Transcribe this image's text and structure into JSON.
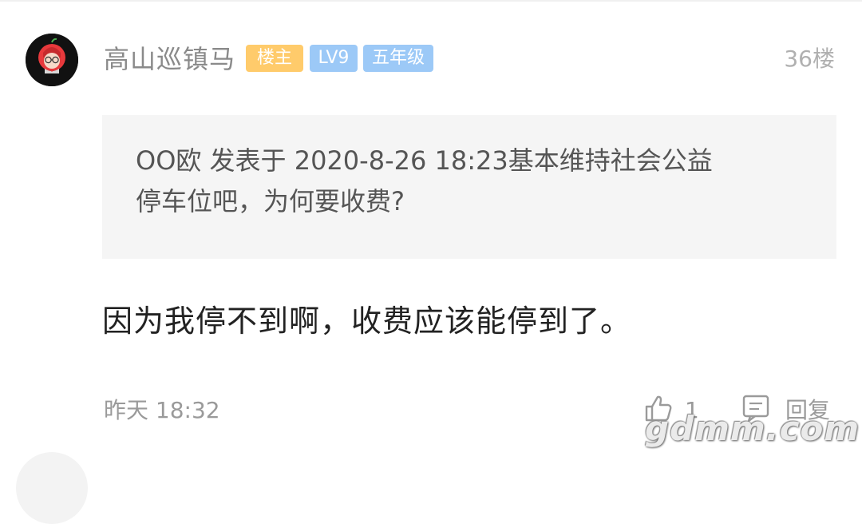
{
  "post": {
    "username": "高山巡镇马",
    "badges": {
      "owner": "楼主",
      "level": "LV9",
      "grade": "五年级"
    },
    "floor": "36楼",
    "quote": {
      "line1": "OO欧 发表于 2020-8-26 18:23基本维持社会公益",
      "line2": "停车位吧，为何要收费?"
    },
    "reply_text": "因为我停不到啊，收费应该能停到了。",
    "time": "昨天 18:32",
    "like_count": "1",
    "reply_label": "回复"
  },
  "watermark": "gdmm.com",
  "icons": {
    "avatar": "avatar-cartoon-girl",
    "like": "thumbs-up-icon",
    "reply": "comment-icon"
  },
  "colors": {
    "owner_badge": "#ffcb6b",
    "level_badge": "#9cc9f7",
    "quote_bg": "#f5f5f5"
  }
}
